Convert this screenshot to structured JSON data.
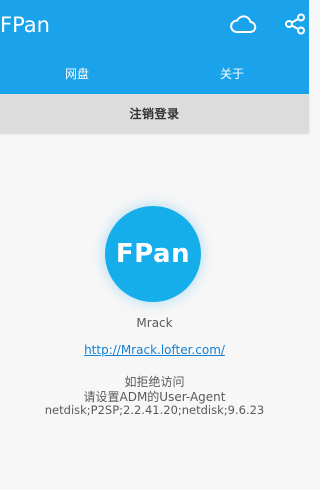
{
  "app": {
    "title": "FPan",
    "accent_color": "#1aa3ea",
    "actions": [
      {
        "icon": "cloud-icon"
      },
      {
        "icon": "share-icon"
      }
    ]
  },
  "tabs": [
    {
      "label": "网盘"
    },
    {
      "label": "关于"
    }
  ],
  "logout": {
    "label": "注销登录"
  },
  "about": {
    "logo_text": "FPan",
    "author": "Mrack",
    "link": "http://Mrack.lofter.com/",
    "notes": [
      "如拒绝访问",
      "请设置ADM的User-Agent",
      "netdisk;P2SP;2.2.41.20;netdisk;9.6.23"
    ]
  }
}
